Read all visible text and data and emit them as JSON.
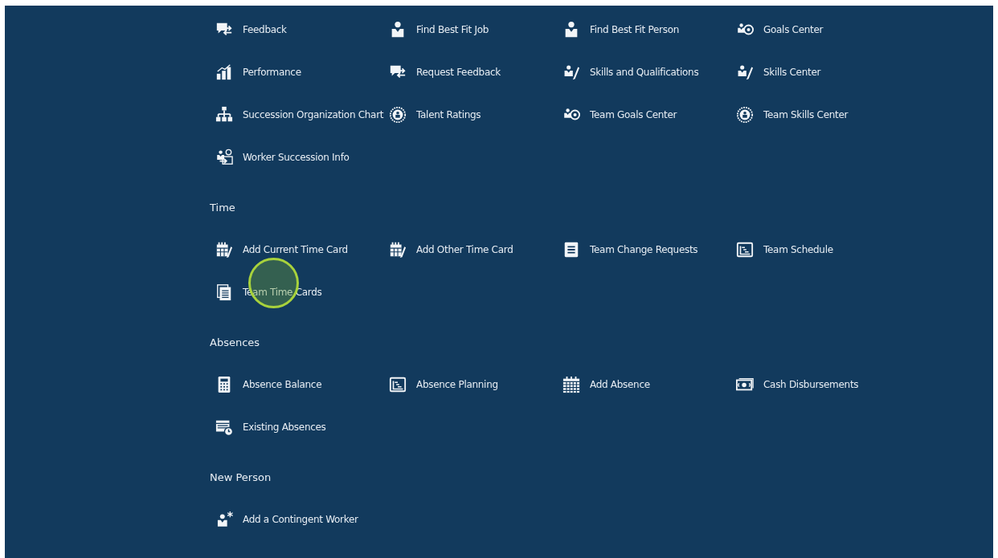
{
  "sections": [
    {
      "items": [
        {
          "label": "Feedback",
          "kind": "feedback"
        },
        {
          "label": "Find Best Fit Job",
          "kind": "person"
        },
        {
          "label": "Find Best Fit Person",
          "kind": "person"
        },
        {
          "label": "Goals Center",
          "kind": "goals"
        },
        {
          "label": "Performance",
          "kind": "chart"
        },
        {
          "label": "Request Feedback",
          "kind": "feedback"
        },
        {
          "label": "Skills and Qualifications",
          "kind": "skills"
        },
        {
          "label": "Skills Center",
          "kind": "skills"
        },
        {
          "label": "Succession Organization Chart",
          "kind": "org"
        },
        {
          "label": "Talent Ratings",
          "kind": "badge"
        },
        {
          "label": "Team Goals Center",
          "kind": "goals"
        },
        {
          "label": "Team Skills Center",
          "kind": "badge"
        },
        {
          "label": "Worker Succession Info",
          "kind": "succession"
        }
      ]
    },
    {
      "title": "Time",
      "items": [
        {
          "label": "Add Current Time Card",
          "kind": "calendar-edit"
        },
        {
          "label": "Add Other Time Card",
          "kind": "calendar-edit"
        },
        {
          "label": "Team Change Requests",
          "kind": "document"
        },
        {
          "label": "Team Schedule",
          "kind": "gantt"
        },
        {
          "label": "Team Time Cards",
          "kind": "stack"
        }
      ]
    },
    {
      "title": "Absences",
      "items": [
        {
          "label": "Absence Balance",
          "kind": "calculator"
        },
        {
          "label": "Absence Planning",
          "kind": "gantt"
        },
        {
          "label": "Add Absence",
          "kind": "calendar"
        },
        {
          "label": "Cash Disbursements",
          "kind": "cash"
        },
        {
          "label": "Existing Absences",
          "kind": "calendar-clock"
        }
      ]
    },
    {
      "title": "New Person",
      "items": [
        {
          "label": "Add a Contingent Worker",
          "kind": "person-add"
        }
      ]
    }
  ],
  "click_highlight": {
    "shown": true
  }
}
